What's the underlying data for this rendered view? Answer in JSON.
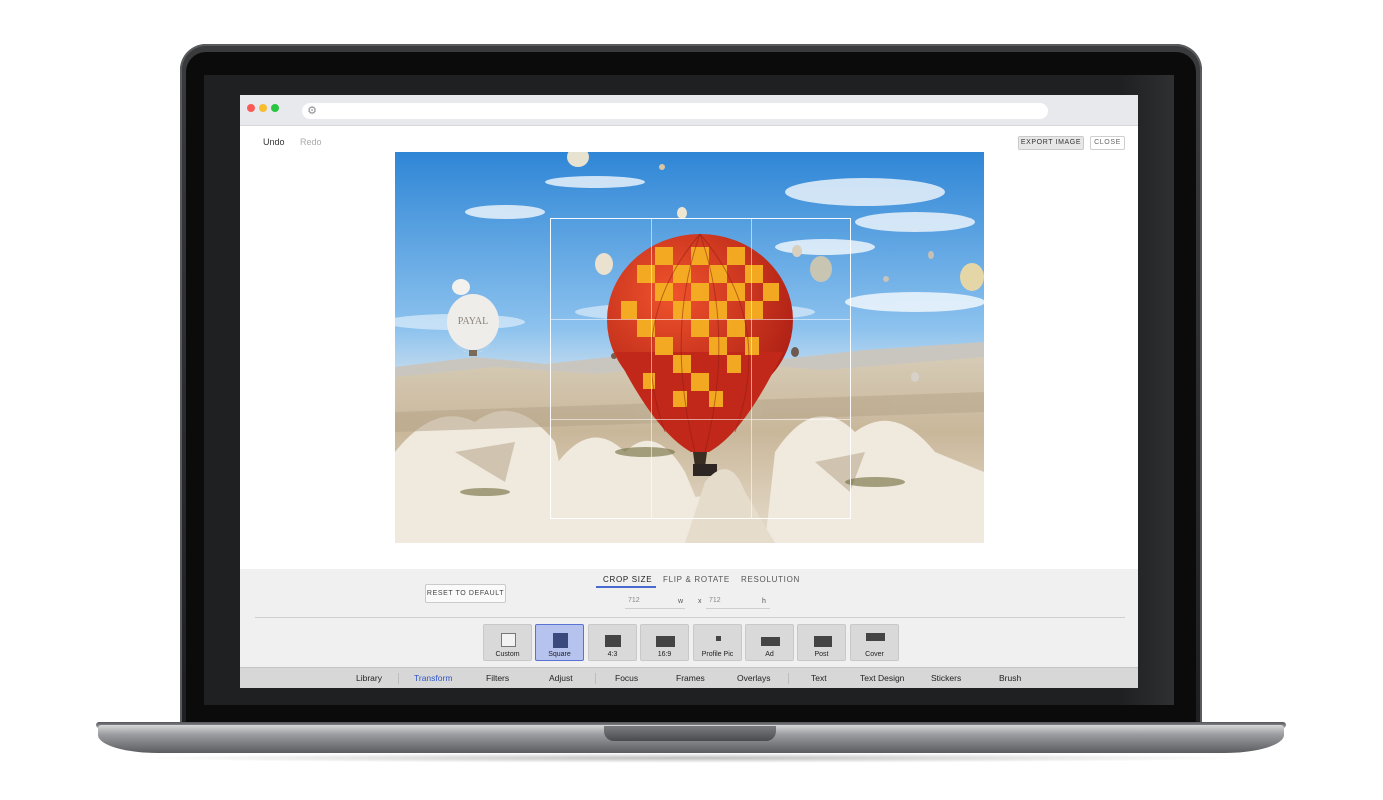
{
  "browser": {
    "url": ""
  },
  "toolbar": {
    "undo_label": "Undo",
    "redo_label": "Redo",
    "export_label": "EXPORT IMAGE",
    "close_label": "CLOSE"
  },
  "image": {
    "balloon_text": "PAYAL"
  },
  "crop_panel": {
    "reset_label": "RESET TO DEFAULT",
    "tabs": [
      {
        "label": "CROP SIZE",
        "active": true
      },
      {
        "label": "FLIP & ROTATE",
        "active": false
      },
      {
        "label": "RESOLUTION",
        "active": false
      }
    ],
    "width_value": "712",
    "width_suffix": "w",
    "separator": "x",
    "height_value": "712",
    "height_suffix": "h",
    "presets": [
      {
        "label": "Custom",
        "active": false
      },
      {
        "label": "Square",
        "active": true
      },
      {
        "label": "4:3",
        "active": false
      },
      {
        "label": "16:9",
        "active": false
      },
      {
        "label": "Profile Pic",
        "active": false
      },
      {
        "label": "Ad",
        "active": false
      },
      {
        "label": "Post",
        "active": false
      },
      {
        "label": "Cover",
        "active": false
      }
    ]
  },
  "nav": {
    "items": [
      {
        "label": "Library",
        "active": false
      },
      {
        "label": "Transform",
        "active": true
      },
      {
        "label": "Filters",
        "active": false
      },
      {
        "label": "Adjust",
        "active": false
      },
      {
        "label": "Focus",
        "active": false
      },
      {
        "label": "Frames",
        "active": false
      },
      {
        "label": "Overlays",
        "active": false
      },
      {
        "label": "Text",
        "active": false
      },
      {
        "label": "Text Design",
        "active": false
      },
      {
        "label": "Stickers",
        "active": false
      },
      {
        "label": "Brush",
        "active": false
      }
    ]
  },
  "colors": {
    "accent": "#2f55c8",
    "active_preset_bg": "#b6c3ee",
    "tab_underline": "#4a6ad0"
  }
}
